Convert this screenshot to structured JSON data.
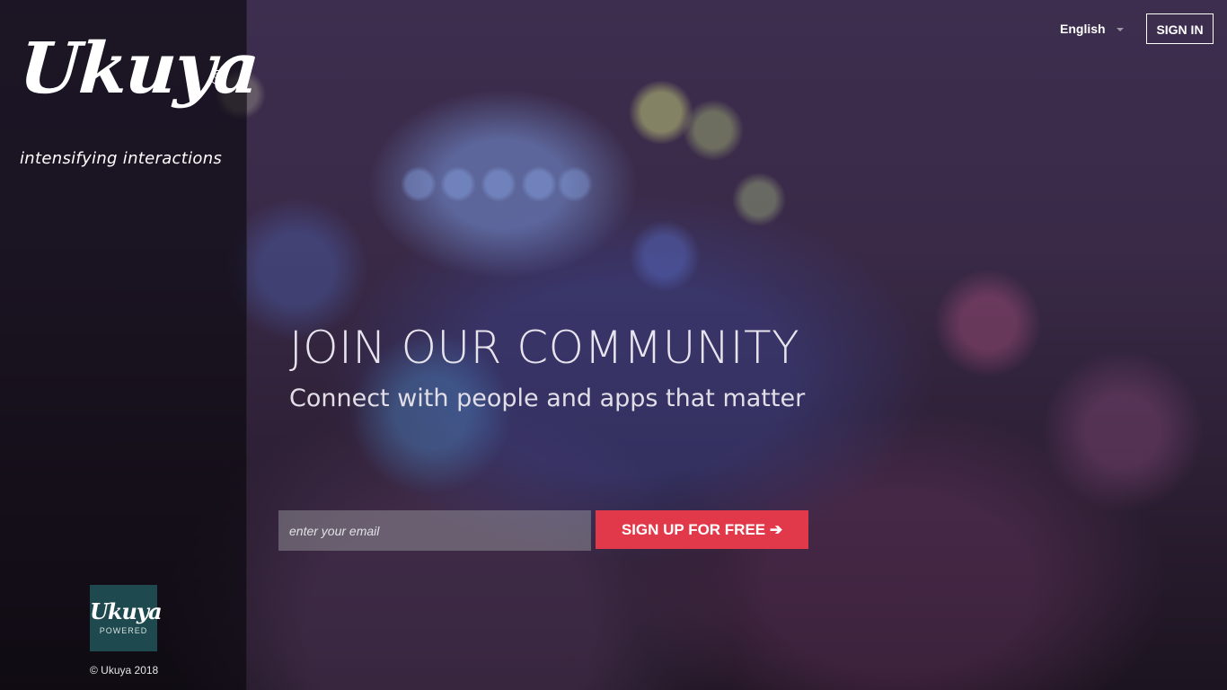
{
  "brand": {
    "logo_text": "Ukuya",
    "registered_mark": "®",
    "tagline": "intensifying interactions"
  },
  "header": {
    "language": "English",
    "sign_in_label": "SIGN IN"
  },
  "hero": {
    "title": "JOIN OUR COMMUNITY",
    "subtitle": "Connect with people and apps that matter"
  },
  "signup": {
    "email_placeholder": "enter your email",
    "email_value": "",
    "button_label": "SIGN UP FOR FREE ➔"
  },
  "footer": {
    "powered_logo_text": "Ukuya",
    "powered_label": "POWERED",
    "copyright": "© Ukuya 2018"
  },
  "colors": {
    "accent": "#e2394a",
    "badge": "#1e4a4f"
  },
  "icons": {
    "language_caret": "chevron-down-icon"
  }
}
